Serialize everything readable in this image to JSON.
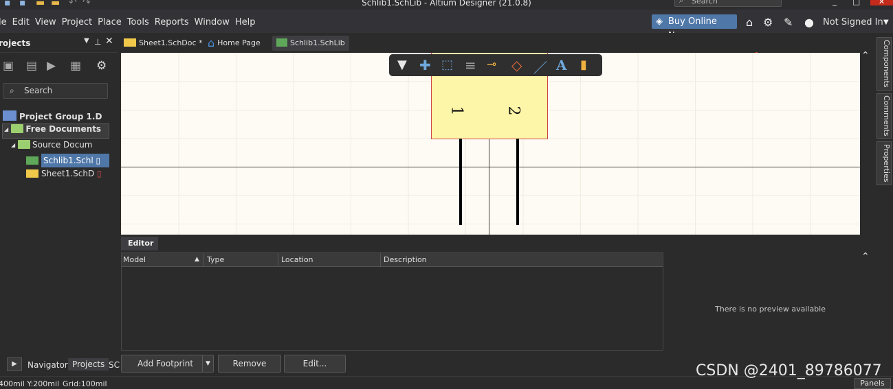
{
  "window": {
    "title": "Schlib1.SchLib - Altium Designer (21.0.8)",
    "search_placeholder": "Search"
  },
  "menu": {
    "items": [
      "le",
      "Edit",
      "View",
      "Project",
      "Place",
      "Tools",
      "Reports",
      "Window",
      "Help"
    ]
  },
  "toolbar": {
    "buy_label": "Buy Online Now",
    "signed_in_label": "Not Signed In"
  },
  "projects_panel": {
    "title": "rojects",
    "search_placeholder": "Search",
    "tree": {
      "group": "Project Group 1.D",
      "free_docs": "Free Documents",
      "source_docs": "Source Docum",
      "schlib": "Schlib1.Schl",
      "sheet": "Sheet1.SchD"
    },
    "bottom_tabs": [
      "Navigator",
      "Projects",
      "SC"
    ]
  },
  "doc_tabs": [
    {
      "label": "Sheet1.SchDoc *"
    },
    {
      "label": "Home Page"
    },
    {
      "label": "Schlib1.SchLib"
    }
  ],
  "canvas": {
    "pin1": "1",
    "pin2": "2"
  },
  "right_panels": [
    "Components",
    "Comments",
    "Properties"
  ],
  "editor": {
    "tab_label": "Editor",
    "columns": [
      "Model",
      "Type",
      "Location",
      "Description"
    ],
    "no_preview": "There is no preview available",
    "buttons": {
      "add_footprint": "Add Footprint",
      "remove": "Remove",
      "edit": "Edit..."
    }
  },
  "status": {
    "coords": "400mil Y:200mil",
    "grid": "Grid:100mil",
    "panels_label": "Panels"
  },
  "watermark": "CSDN @2401_89786077",
  "colors": {
    "accent": "#4f77a8",
    "canvas_bg": "#fdfbf3",
    "component_fill": "#fdf5a8",
    "arrow": "#e8473a"
  }
}
